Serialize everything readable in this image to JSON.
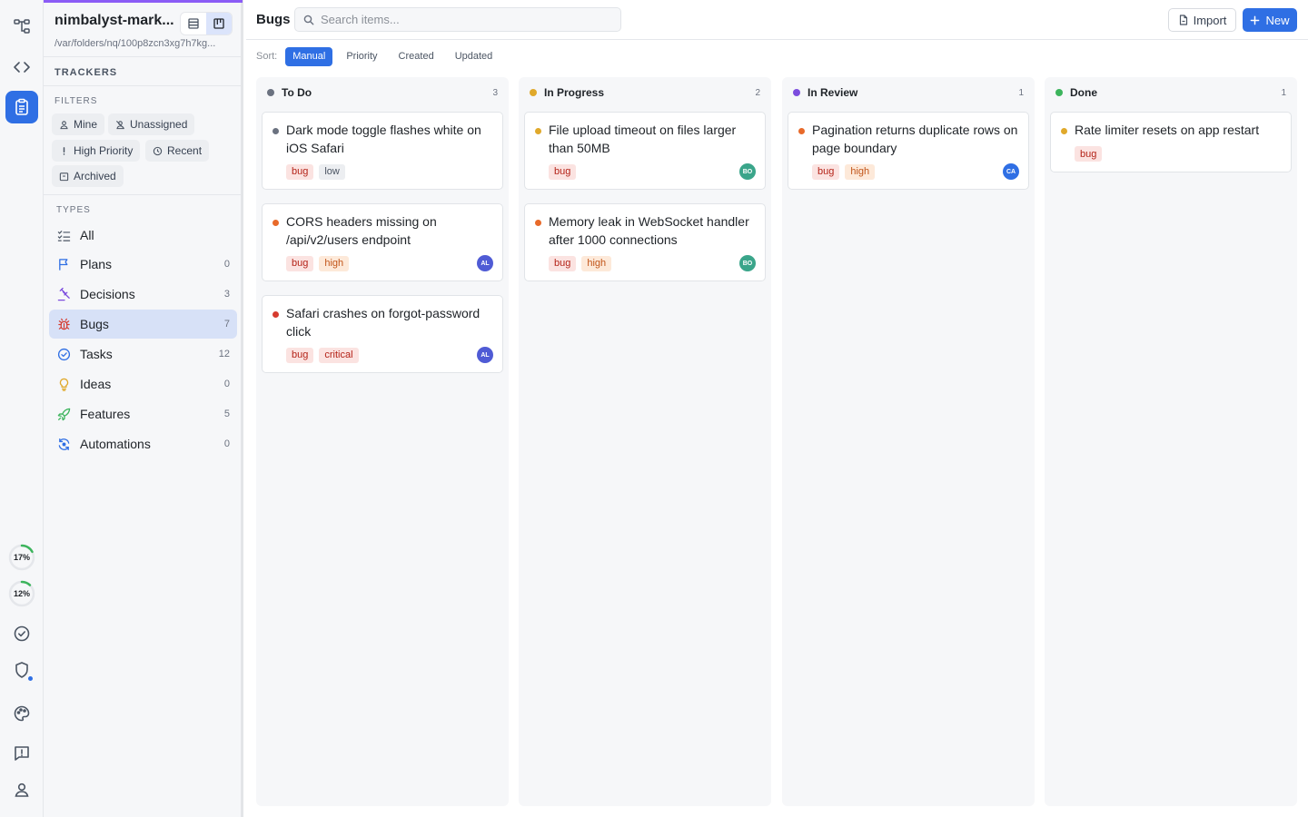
{
  "colors": {
    "accent": "#2f6fe4",
    "project_bar": "#8b5cf6",
    "status_todo": "#6b7280",
    "status_in_progress": "#e0a92b",
    "status_in_review": "#7c4dde",
    "status_done": "#3cb45c",
    "priority_low": "#6b7280",
    "priority_medium": "#e0a92b",
    "priority_high": "#e86a2a",
    "priority_critical": "#d63b2f"
  },
  "rail": {
    "icons": [
      "graph-icon",
      "code-icon",
      "clipboard-icon",
      "check-circle-icon",
      "shield-icon",
      "palette-icon",
      "feedback-icon",
      "user-icon"
    ],
    "usage": [
      {
        "label": "17%",
        "value": 0.17
      },
      {
        "label": "12%",
        "value": 0.12
      }
    ]
  },
  "sidebar": {
    "project_name": "nimbalyst-mark...",
    "project_path": "/var/folders/nq/100p8zcn3xg7h7kg...",
    "trackers_heading": "TRACKERS",
    "filters_heading": "FILTERS",
    "filters": [
      {
        "label": "Mine",
        "icon": "user-icon"
      },
      {
        "label": "Unassigned",
        "icon": "user-off-icon"
      },
      {
        "label": "High Priority",
        "icon": "exclamation-icon"
      },
      {
        "label": "Recent",
        "icon": "clock-icon"
      },
      {
        "label": "Archived",
        "icon": "archive-icon"
      }
    ],
    "types_heading": "TYPES",
    "types": [
      {
        "label": "All",
        "count": "",
        "icon": "list-check-icon"
      },
      {
        "label": "Plans",
        "count": "0",
        "icon": "flag-icon"
      },
      {
        "label": "Decisions",
        "count": "3",
        "icon": "gavel-icon"
      },
      {
        "label": "Bugs",
        "count": "7",
        "icon": "bug-icon",
        "active": true
      },
      {
        "label": "Tasks",
        "count": "12",
        "icon": "check-circle-icon"
      },
      {
        "label": "Ideas",
        "count": "0",
        "icon": "lightbulb-icon"
      },
      {
        "label": "Features",
        "count": "5",
        "icon": "rocket-icon"
      },
      {
        "label": "Automations",
        "count": "0",
        "icon": "automation-icon"
      }
    ]
  },
  "header": {
    "title": "Bugs",
    "search_placeholder": "Search items...",
    "import_label": "Import",
    "new_label": "New"
  },
  "sort": {
    "label": "Sort:",
    "options": [
      "Manual",
      "Priority",
      "Created",
      "Updated"
    ],
    "selected": "Manual"
  },
  "columns": [
    {
      "title": "To Do",
      "count": "3",
      "status": "todo",
      "cards": [
        {
          "title": "Dark mode toggle flashes white on iOS Safari",
          "priority": "low",
          "tags": [
            "bug",
            "low"
          ],
          "assignee": ""
        },
        {
          "title": "CORS headers missing on /api/v2/users endpoint",
          "priority": "high",
          "tags": [
            "bug",
            "high"
          ],
          "assignee": "AL"
        },
        {
          "title": "Safari crashes on forgot-password click",
          "priority": "critical",
          "tags": [
            "bug",
            "critical"
          ],
          "assignee": "AL"
        }
      ]
    },
    {
      "title": "In Progress",
      "count": "2",
      "status": "in_progress",
      "cards": [
        {
          "title": "File upload timeout on files larger than 50MB",
          "priority": "medium",
          "tags": [
            "bug"
          ],
          "assignee": "BO"
        },
        {
          "title": "Memory leak in WebSocket handler after 1000 connections",
          "priority": "high",
          "tags": [
            "bug",
            "high"
          ],
          "assignee": "BO"
        }
      ]
    },
    {
      "title": "In Review",
      "count": "1",
      "status": "in_review",
      "cards": [
        {
          "title": "Pagination returns duplicate rows on page boundary",
          "priority": "high",
          "tags": [
            "bug",
            "high"
          ],
          "assignee": "CA"
        }
      ]
    },
    {
      "title": "Done",
      "count": "1",
      "status": "done",
      "cards": [
        {
          "title": "Rate limiter resets on app restart",
          "priority": "medium",
          "tags": [
            "bug"
          ],
          "assignee": ""
        }
      ]
    }
  ],
  "avatar_colors": {
    "AL": "#4f5bd5",
    "BO": "#3aa58a",
    "CA": "#2f6fe4"
  }
}
